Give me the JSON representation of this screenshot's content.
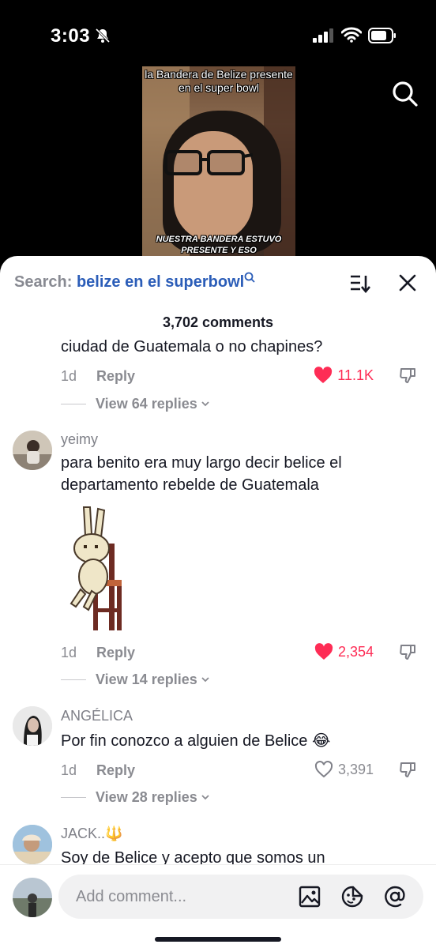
{
  "status_bar": {
    "time": "3:03"
  },
  "video": {
    "caption_top": "la Bandera de Belize presente en el super bowl",
    "caption_bottom_1": "NUESTRA BANDERA ESTUVO",
    "caption_bottom_2": "PRESENTE Y ESO"
  },
  "sheet": {
    "search_label": "Search:",
    "search_query": "belize en el superbowl",
    "comment_count": "3,702 comments"
  },
  "comments": [
    {
      "username": "",
      "text": "ciudad de Guatemala o no chapines?",
      "age": "1d",
      "reply_label": "Reply",
      "likes": "11.1K",
      "liked": true,
      "view_replies": "View 64 replies"
    },
    {
      "username": "yeimy",
      "text": "para benito era muy largo decir belice el departamento rebelde de Guatemala",
      "age": "1d",
      "reply_label": "Reply",
      "likes": "2,354",
      "liked": true,
      "view_replies": "View 14 replies"
    },
    {
      "username": "ANGÉLICA",
      "text": "Por fin conozco a alguien de Belice 😂",
      "age": "1d",
      "reply_label": "Reply",
      "likes": "3,391",
      "liked": false,
      "view_replies": "View 28 replies"
    },
    {
      "username": "JACK..🔱",
      "text": "Soy de Belice y acepto que somos un"
    }
  ],
  "input": {
    "placeholder": "Add comment..."
  },
  "colors": {
    "like_red": "#fe2c55",
    "query_blue": "#2b5db8",
    "muted": "#8a8b91"
  }
}
